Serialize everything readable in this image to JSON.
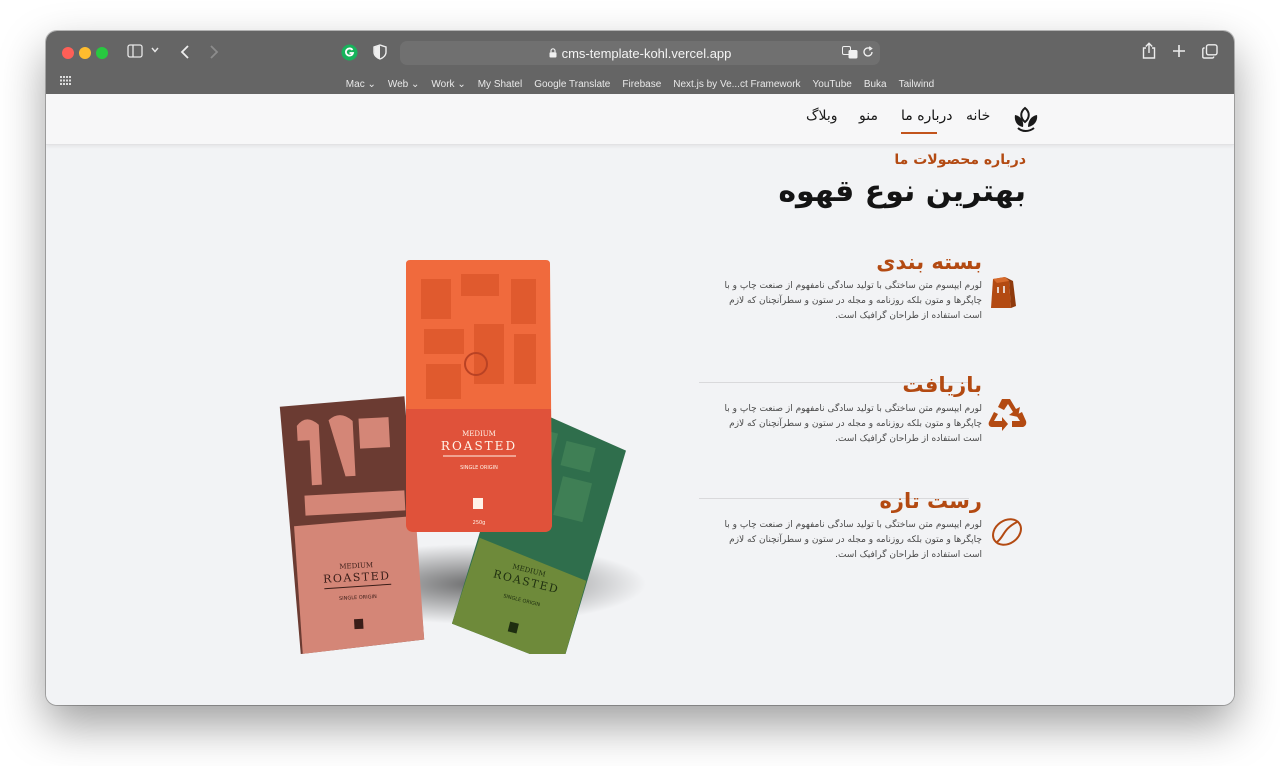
{
  "browser": {
    "url": "cms-template-kohl.vercel.app",
    "bookmarks": [
      "Mac ⌄",
      "Web ⌄",
      "Work ⌄",
      "My Shatel",
      "Google Translate",
      "Firebase",
      "Next.js by Ve...ct Framework",
      "YouTube",
      "Buka",
      "Tailwind"
    ]
  },
  "nav": {
    "items": [
      "خانه",
      "درباره ما",
      "منو",
      "وبلاگ"
    ],
    "active_index": 1,
    "logo_icon": "leaves-logo-icon"
  },
  "about": {
    "eyebrow": "درباره محصولات ما",
    "heading": "بهترین نوع قهوه"
  },
  "features": [
    {
      "title": "بسته بندی",
      "icon": "coffee-bag-icon",
      "desc": "لورم ایپسوم متن ساختگی با تولید سادگی نامفهوم از صنعت چاپ و با چاپگرها و متون بلکه روزنامه و مجله در ستون و سطرآنچنان که لازم است استفاده از طراحان گرافیک است."
    },
    {
      "title": "بازیافت",
      "icon": "recycle-icon",
      "desc": "لورم ایپسوم متن ساختگی با تولید سادگی نامفهوم از صنعت چاپ و با چاپگرها و متون بلکه روزنامه و مجله در ستون و سطرآنچنان که لازم است استفاده از طراحان گرافیک است."
    },
    {
      "title": "رست تازه",
      "icon": "coffee-bean-icon",
      "desc": "لورم ایپسوم متن ساختگی با تولید سادگی نامفهوم از صنعت چاپ و با چاپگرها و متون بلکه روزنامه و مجله در ستون و سطرآنچنان که لازم است استفاده از طراحان گرافیک است."
    }
  ],
  "bags": {
    "left": {
      "line1": "MEDIUM",
      "line2": "ROASTED",
      "line3": "SINGLE ORIGIN",
      "color": "#d98b80"
    },
    "center": {
      "line1": "MEDIUM",
      "line2": "ROASTED",
      "line3": "SINGLE ORIGIN",
      "weight": "250g",
      "color": "#e8543a"
    },
    "right": {
      "line1": "MEDIUM",
      "line2": "ROASTED",
      "line3": "SINGLE ORIGIN",
      "color": "#5e7f3a"
    }
  },
  "colors": {
    "accent": "#b34a12",
    "heading": "#141414",
    "titlebar": "#656565"
  }
}
